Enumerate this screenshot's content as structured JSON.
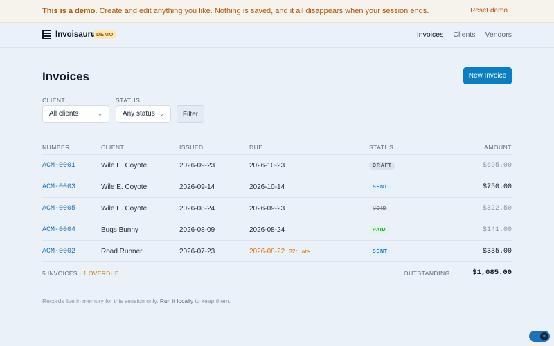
{
  "banner": {
    "lead": "This is a demo.",
    "text": " Create and edit anything you like. Nothing is saved, and it all disappears when your session ends.",
    "reset_label": "Reset demo"
  },
  "nav": {
    "brand": "Invoisaurus",
    "badge": "DEMO",
    "links": [
      "Invoices",
      "Clients",
      "Vendors"
    ],
    "active": "Invoices"
  },
  "page": {
    "title": "Invoices",
    "new_button": "New Invoice"
  },
  "filters": {
    "client_label": "CLIENT",
    "client_value": "All clients",
    "status_label": "STATUS",
    "status_value": "Any status",
    "filter_button": "Filter"
  },
  "table": {
    "headers": {
      "number": "NUMBER",
      "client": "CLIENT",
      "issued": "ISSUED",
      "due": "DUE",
      "status": "STATUS",
      "amount": "AMOUNT"
    },
    "rows": [
      {
        "number": "ACM-0001",
        "client": "Wile E. Coyote",
        "issued": "2026-09-23",
        "due": "2026-10-23",
        "late": "",
        "status": "DRAFT",
        "amount": "$695.00"
      },
      {
        "number": "ACM-0003",
        "client": "Wile E. Coyote",
        "issued": "2026-09-14",
        "due": "2026-10-14",
        "late": "",
        "status": "SENT",
        "amount": "$750.00"
      },
      {
        "number": "ACM-0005",
        "client": "Wile E. Coyote",
        "issued": "2026-08-24",
        "due": "2026-09-23",
        "late": "",
        "status": "VOID",
        "amount": "$322.50"
      },
      {
        "number": "ACM-0004",
        "client": "Bugs Bunny",
        "issued": "2026-08-09",
        "due": "2026-08-24",
        "late": "",
        "status": "PAID",
        "amount": "$141.00"
      },
      {
        "number": "ACM-0002",
        "client": "Road Runner",
        "issued": "2026-07-23",
        "due": "2026-08-22",
        "late": "32d late",
        "status": "SENT",
        "amount": "$335.00"
      }
    ]
  },
  "footer": {
    "count": "5 INVOICES",
    "separator": " · ",
    "overdue": "1 OVERDUE",
    "outstanding_label": "OUTSTANDING",
    "outstanding_value": "$1,085.00"
  },
  "note": {
    "before": "Records live in memory for this session only. ",
    "link": "Run it locally",
    "after": " to keep them."
  },
  "colors": {
    "accent": "#0a7ec2",
    "link": "#1d73b5",
    "warning": "#b45309",
    "overdue": "#d97706"
  },
  "icons": {
    "logo": "stacked-lines-icon",
    "select": "chevron-down-icon",
    "theme_toggle": "sun-icon"
  }
}
